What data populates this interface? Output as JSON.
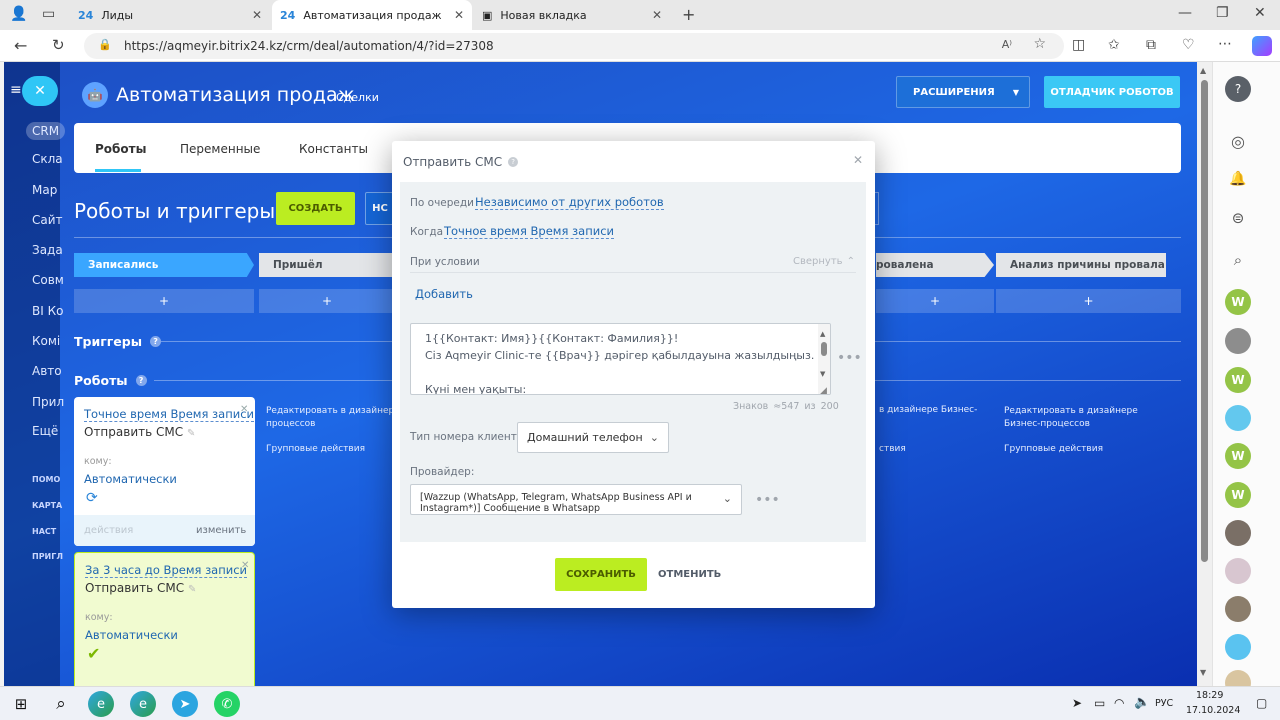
{
  "browser": {
    "tabs": [
      {
        "icon": "24",
        "label": "Лиды"
      },
      {
        "icon": "24",
        "label": "Автоматизация продаж"
      },
      {
        "icon": "tab-icon",
        "label": "Новая вкладка"
      }
    ],
    "url": "https://aqmeyir.bitrix24.kz/crm/deal/automation/4/?id=27308"
  },
  "left_menu": {
    "items": [
      "CRM",
      "Скла",
      "Мар",
      "Сайт",
      "Зада",
      "Совм",
      "BI Ко",
      "Комі",
      "Авто",
      "Прил",
      "Ещё"
    ],
    "small": [
      "ПОМО",
      "КАРТА",
      "НАСТ",
      "ПРИГЛ"
    ]
  },
  "header": {
    "title": "Автоматизация продаж",
    "subtitle": "Сделки",
    "extensions_label": "РАСШИРЕНИЯ",
    "debugger_label": "ОТЛАДЧИК РОБОТОВ"
  },
  "tabs": [
    "Роботы",
    "Переменные",
    "Константы"
  ],
  "section": {
    "title": "Роботы и триггеры",
    "create_label": "СОЗДАТЬ",
    "second_button_partial": "НС"
  },
  "stages": {
    "left": [
      "Записались",
      "Пришёл"
    ],
    "right": [
      "ровалена",
      "Анализ причины провала"
    ]
  },
  "triggers_label": "Триггеры",
  "robots_label": "Роботы",
  "robot_cards": [
    {
      "link": "Точное время Время записи",
      "name": "Отправить СМС",
      "to_label": "кому:",
      "to_value": "Автоматически",
      "footer_left": "действия",
      "footer_right": "изменить"
    },
    {
      "link": "За 3 часа до Время записи",
      "name": "Отправить СМС",
      "to_label": "кому:",
      "to_value": "Автоматически"
    }
  ],
  "column_links": {
    "designer": "Редактировать в дизайнере Бизнес-процессов",
    "group": "Групповые действия",
    "designer_partial": "Редактировать в дизайнере Б",
    "designer_partial2": "процессов",
    "designer_right_partial": "в дизайнере Бизнес-",
    "group_right_partial": "ствия"
  },
  "modal": {
    "title": "Отправить СМС",
    "queue_label": "По очереди",
    "queue_value": "Независимо от других роботов",
    "when_label": "Когда",
    "when_value": "Точное время Время записи",
    "condition_label": "При условии",
    "collapse_label": "Свернуть",
    "add_label": "Добавить",
    "message_line1": "1{{Контакт: Имя}}{{Контакт: Фамилия}}!",
    "message_line2": "Сіз Aqmeyir Clinic-те {{Врач}} дәрігер қабылдауына жазылдыңыз.",
    "message_line3": "Күні мен уақыты:",
    "chars_label": "Знаков",
    "chars_count": "≈547",
    "chars_of": "из",
    "chars_max": "200",
    "phone_type_label": "Тип номера клиента:",
    "phone_type_value": "Домашний телефон",
    "provider_label": "Провайдер:",
    "provider_value": "[Wazzup (WhatsApp, Telegram, WhatsApp Business API и Instagram*)] Сообщение в Whatsapp",
    "save_label": "СОХРАНИТЬ",
    "cancel_label": "ОТМЕНИТЬ"
  },
  "taskbar": {
    "lang": "РУС",
    "time": "18:29",
    "date": "17.10.2024"
  },
  "colors": {
    "accent_green": "#bbed21",
    "blue_btn": "#3bc8f5",
    "link": "#2067b0"
  }
}
